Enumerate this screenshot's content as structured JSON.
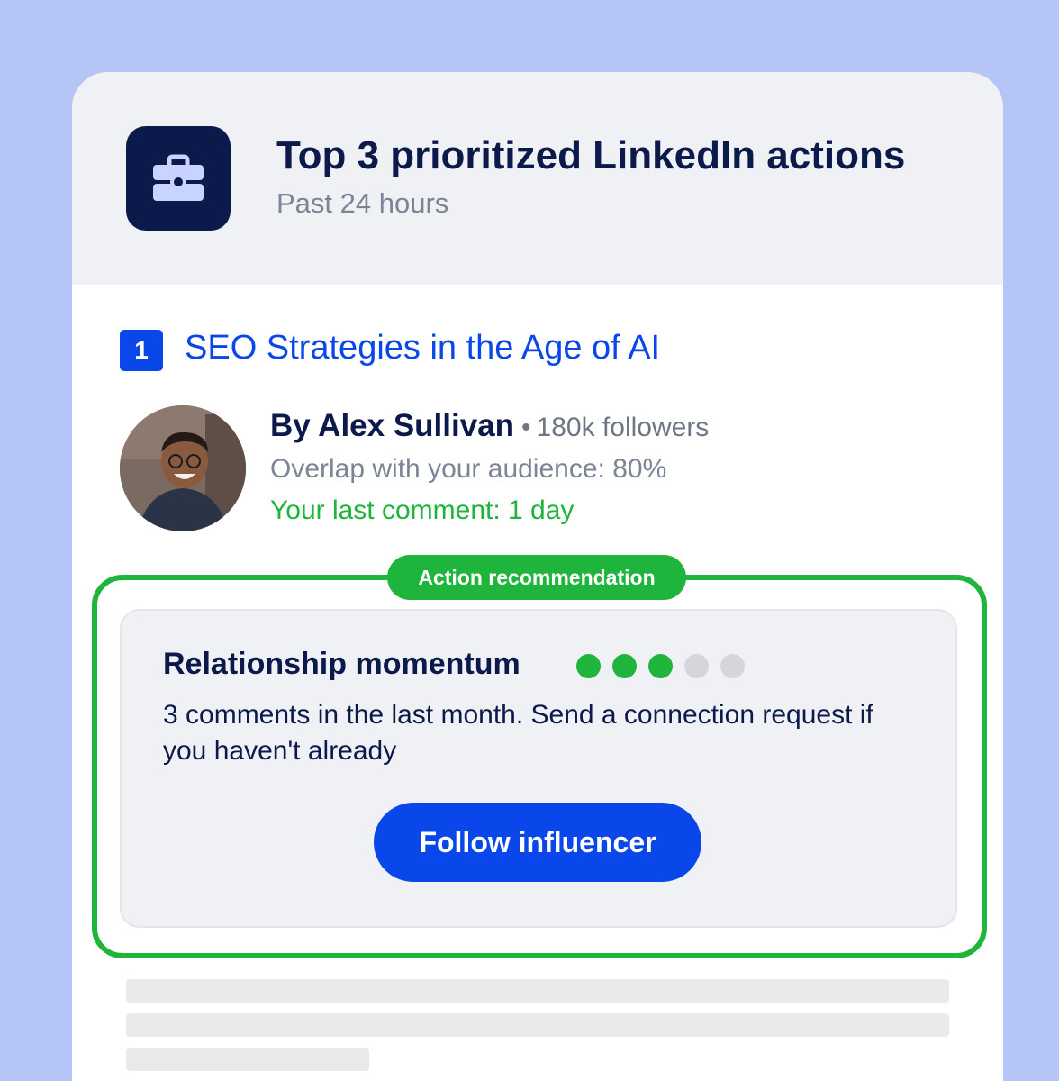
{
  "header": {
    "icon": "briefcase-icon",
    "title": "Top 3 prioritized LinkedIn actions",
    "subtitle": "Past 24 hours"
  },
  "item": {
    "rank": "1",
    "title": "SEO Strategies in the Age of AI",
    "author": {
      "name": "By Alex Sullivan",
      "separator": "•",
      "followers": "180k followers",
      "overlap": "Overlap with your audience: 80%",
      "last_comment": "Your last comment: 1 day"
    }
  },
  "action": {
    "label": "Action recommendation",
    "momentum_title": "Relationship momentum",
    "momentum_level": 3,
    "momentum_max": 5,
    "description": "3 comments in the last month. Send a connection request if you haven't already",
    "button_label": "Follow influencer"
  },
  "colors": {
    "brand_blue": "#0a47ea",
    "navy": "#0c1a4b",
    "green": "#1fb43c",
    "dot_inactive": "#d4d6db"
  }
}
